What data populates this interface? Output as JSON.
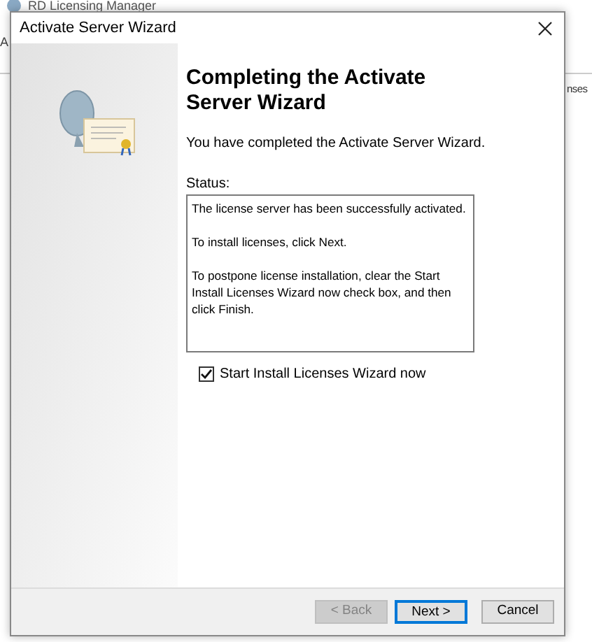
{
  "background_window": {
    "title": "RD Licensing Manager",
    "menu_fragment": "A",
    "column_fragment": "nses"
  },
  "dialog": {
    "title": "Activate Server Wizard",
    "heading": "Completing the Activate Server Wizard",
    "intro": "You have completed the Activate Server Wizard.",
    "status_label": "Status:",
    "status_lines": [
      "The license server has been successfully activated.",
      "To install licenses, click Next.",
      "To postpone license installation, clear the Start Install Licenses Wizard now check box, and then click Finish."
    ],
    "checkbox": {
      "label": "Start Install Licenses Wizard now",
      "checked": true
    },
    "buttons": [
      {
        "label": "< Back",
        "disabled": true,
        "default": false
      },
      {
        "label": "Next >",
        "disabled": false,
        "default": true
      },
      {
        "label": "Cancel",
        "disabled": false,
        "default": false
      }
    ]
  }
}
